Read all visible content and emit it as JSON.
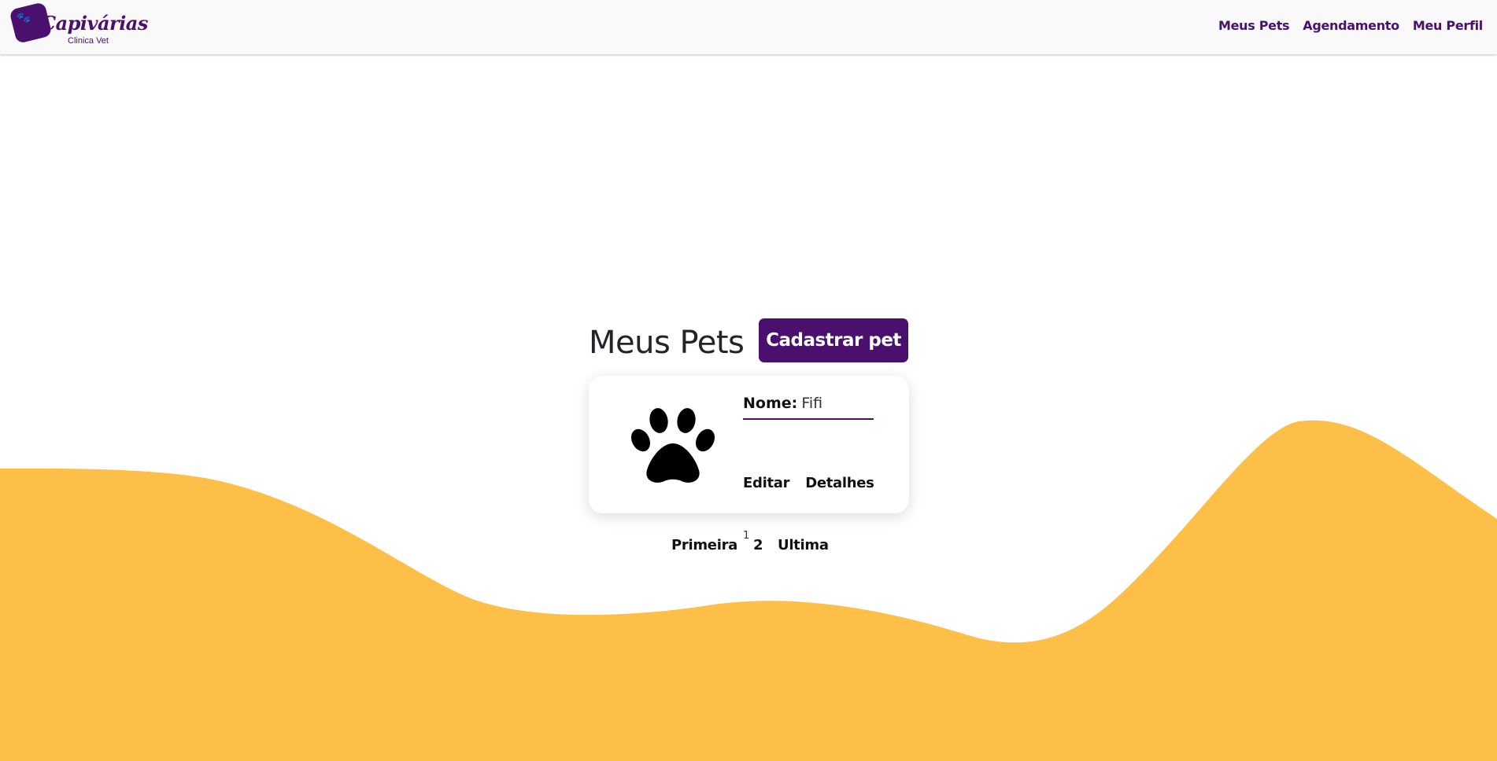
{
  "brand": {
    "name": "Capivárias",
    "subtitle": "Clinica Vet"
  },
  "nav": {
    "links": [
      {
        "label": "Meus Pets"
      },
      {
        "label": "Agendamento"
      },
      {
        "label": "Meu Perfil"
      }
    ]
  },
  "main": {
    "title": "Meus Pets",
    "add_button": "Cadastrar pet"
  },
  "pets": [
    {
      "name_label": "Nome:",
      "name": "Fifi",
      "photo_icon": "paw-icon",
      "edit_label": "Editar",
      "details_label": "Detalhes"
    }
  ],
  "pagination": {
    "first": "Primeira",
    "current": "1",
    "next": "2",
    "last": "Ultima"
  },
  "colors": {
    "brand_purple": "#4b0f6d",
    "wave_yellow": "#fdbf47",
    "navbar_bg": "#f9f9f9"
  }
}
